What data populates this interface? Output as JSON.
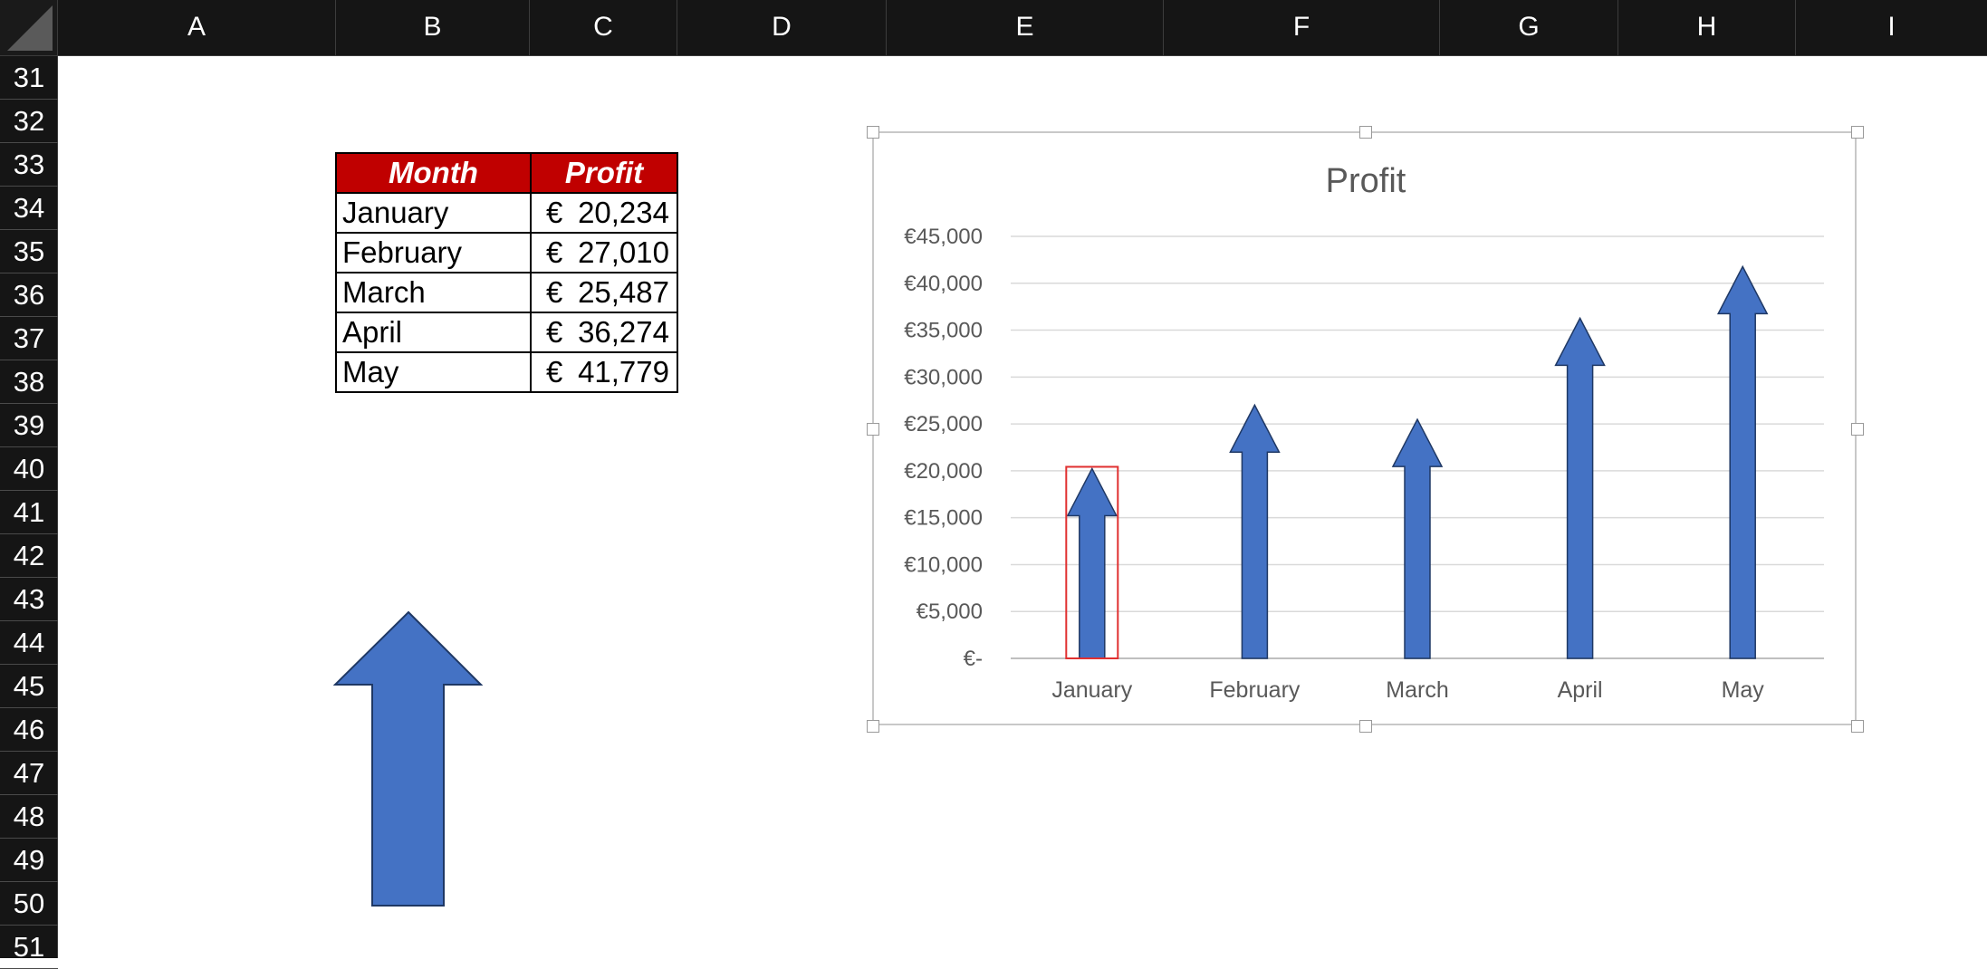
{
  "columns": [
    "A",
    "B",
    "C",
    "D",
    "E",
    "F",
    "G",
    "H",
    "I"
  ],
  "rows": [
    "31",
    "32",
    "33",
    "34",
    "35",
    "36",
    "37",
    "38",
    "39",
    "40",
    "41",
    "42",
    "43",
    "44",
    "45",
    "46",
    "47",
    "48",
    "49",
    "50",
    "51"
  ],
  "table": {
    "headers": [
      "Month",
      "Profit"
    ],
    "rows": [
      {
        "month": "January",
        "currency": "€",
        "amount": "20,234"
      },
      {
        "month": "February",
        "currency": "€",
        "amount": "27,010"
      },
      {
        "month": "March",
        "currency": "€",
        "amount": "25,487"
      },
      {
        "month": "April",
        "currency": "€",
        "amount": "36,274"
      },
      {
        "month": "May",
        "currency": "€",
        "amount": "41,779"
      }
    ]
  },
  "colors": {
    "header_fill": "#c00000",
    "arrow_fill": "#4472c4",
    "arrow_stroke": "#1f3864",
    "selection": "#e03030"
  },
  "chart_data": {
    "type": "bar",
    "title": "Profit",
    "categories": [
      "January",
      "February",
      "March",
      "April",
      "May"
    ],
    "values": [
      20234,
      27010,
      25487,
      36274,
      41779
    ],
    "ylim": [
      0,
      45000
    ],
    "yticks": [
      0,
      5000,
      10000,
      15000,
      20000,
      25000,
      30000,
      35000,
      40000,
      45000
    ],
    "ytick_labels": [
      "€-",
      "€5,000",
      "€10,000",
      "€15,000",
      "€20,000",
      "€25,000",
      "€30,000",
      "€35,000",
      "€40,000",
      "€45,000"
    ],
    "grid": true,
    "bar_shape": "arrow-icon",
    "selected_category": "January"
  }
}
